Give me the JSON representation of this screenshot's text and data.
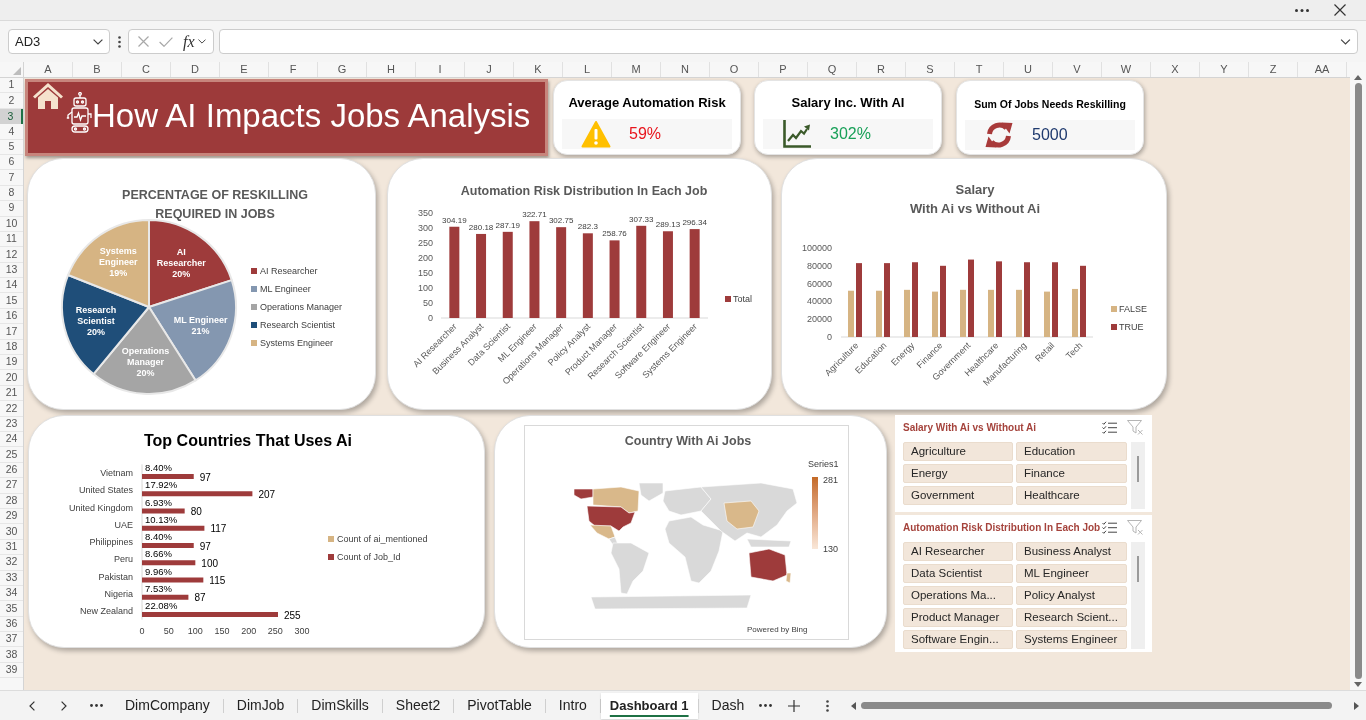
{
  "formula_bar": {
    "name_box": "AD3",
    "function_button": "fx"
  },
  "column_headers": [
    "A",
    "B",
    "C",
    "D",
    "E",
    "F",
    "G",
    "H",
    "I",
    "J",
    "K",
    "L",
    "M",
    "N",
    "O",
    "P",
    "Q",
    "R",
    "S",
    "T",
    "U",
    "V",
    "W",
    "X",
    "Y",
    "Z",
    "AA"
  ],
  "row_headers": [
    {
      "label": "1",
      "selected": false
    },
    {
      "label": "2",
      "selected": false
    },
    {
      "label": "3",
      "selected": true
    },
    {
      "label": "4",
      "selected": false
    },
    {
      "label": "5",
      "selected": false
    },
    {
      "label": "6",
      "selected": false
    },
    {
      "label": "7",
      "selected": false
    },
    {
      "label": "8",
      "selected": false
    },
    {
      "label": "9",
      "selected": false
    },
    {
      "label": "10",
      "selected": false
    },
    {
      "label": "11",
      "selected": false
    },
    {
      "label": "12",
      "selected": false
    },
    {
      "label": "13",
      "selected": false
    },
    {
      "label": "14",
      "selected": false
    },
    {
      "label": "15",
      "selected": false
    },
    {
      "label": "16",
      "selected": false
    },
    {
      "label": "17",
      "selected": false
    },
    {
      "label": "18",
      "selected": false
    },
    {
      "label": "19",
      "selected": false
    },
    {
      "label": "20",
      "selected": false
    },
    {
      "label": "21",
      "selected": false
    },
    {
      "label": "22",
      "selected": false
    },
    {
      "label": "23",
      "selected": false
    },
    {
      "label": "24",
      "selected": false
    },
    {
      "label": "25",
      "selected": false
    },
    {
      "label": "26",
      "selected": false
    },
    {
      "label": "27",
      "selected": false
    },
    {
      "label": "28",
      "selected": false
    },
    {
      "label": "29",
      "selected": false
    },
    {
      "label": "30",
      "selected": false
    },
    {
      "label": "31",
      "selected": false
    },
    {
      "label": "32",
      "selected": false
    },
    {
      "label": "33",
      "selected": false
    },
    {
      "label": "34",
      "selected": false
    },
    {
      "label": "35",
      "selected": false
    },
    {
      "label": "36",
      "selected": false
    },
    {
      "label": "37",
      "selected": false
    },
    {
      "label": "38",
      "selected": false
    },
    {
      "label": "39",
      "selected": false
    }
  ],
  "dashboard": {
    "title": "How AI Impacts Jobs Analysis",
    "kpis": [
      {
        "kind": "warning",
        "title": "Average Automation Risk",
        "value": "59%"
      },
      {
        "kind": "growth",
        "title": "Salary Inc. With AI",
        "value": "302%"
      },
      {
        "kind": "cycle",
        "title": "Sum Of Jobs Needs Reskilling",
        "value": "5000"
      }
    ],
    "reskilling_chart": {
      "chart_data": {
        "type": "pie",
        "title": "PERCENTAGE OF RESKILLING REQUIRED IN JOBS",
        "categories": [
          "AI Researcher",
          "ML Engineer",
          "Operations Manager",
          "Research Scientist",
          "Systems Engineer"
        ],
        "values": [
          20,
          21,
          20,
          20,
          19
        ],
        "colors": [
          "#9e3b3b",
          "#8497b0",
          "#a5a5a5",
          "#1f4e79",
          "#d6b483"
        ],
        "data_labels": "value_labels",
        "value_labels": [
          "20%",
          "21%",
          "20%",
          "20%",
          "19%"
        ],
        "legend": "right"
      }
    },
    "automation_chart": {
      "chart_data": {
        "type": "bar",
        "title": "Automation Risk Distribution In Each Job",
        "categories": [
          "AI Researcher",
          "Business Analyst",
          "Data Scientist",
          "ML Engineer",
          "Operations Manager",
          "Policy Analyst",
          "Product Manager",
          "Research Scientist",
          "Software Engineer",
          "Systems Engineer"
        ],
        "series": [
          {
            "name": "Total",
            "color": "#9e3b3b",
            "values": [
              304.19,
              280.18,
              287.19,
              322.71,
              302.75,
              282.3,
              258.76,
              307.33,
              289.13,
              296.34
            ]
          }
        ],
        "ylim": [
          0,
          350
        ],
        "yticks": [
          0,
          50,
          100,
          150,
          200,
          250,
          300,
          350
        ],
        "data_labels": true,
        "legend": "right"
      }
    },
    "salary_chart": {
      "chart_data": {
        "type": "bar",
        "title": "Salary\nWith Ai vs Without Ai",
        "categories": [
          "Agriculture",
          "Education",
          "Energy",
          "Finance",
          "Government",
          "Healthcare",
          "Manufacturing",
          "Retail",
          "Tech"
        ],
        "series": [
          {
            "name": "FALSE",
            "color": "#d6b483",
            "values": [
              52000,
              52000,
              53000,
              51000,
              53000,
              53000,
              53000,
              51000,
              54000
            ]
          },
          {
            "name": "TRUE",
            "color": "#9e3b3b",
            "values": [
              83000,
              83000,
              84000,
              80000,
              87000,
              85000,
              84000,
              84000,
              80000
            ]
          }
        ],
        "ylim": [
          0,
          100000
        ],
        "yticks": [
          0,
          20000,
          40000,
          60000,
          80000,
          100000
        ],
        "legend": "right"
      }
    },
    "countries_chart": {
      "chart_data": {
        "type": "bar",
        "orientation": "horizontal",
        "title": "Top Countries That Uses Ai",
        "categories": [
          "Vietnam",
          "United States",
          "United Kingdom",
          "UAE",
          "Philippines",
          "Peru",
          "Pakistan",
          "Nigeria",
          "New Zealand"
        ],
        "series": [
          {
            "name": "Count of ai_mentioned",
            "color": "#d6b483",
            "values": [
              0.084,
              0.1792,
              0.0693,
              0.1013,
              0.084,
              0.0866,
              0.0996,
              0.0753,
              0.2208
            ],
            "value_labels": [
              "8.40%",
              "17.92%",
              "6.93%",
              "10.13%",
              "8.40%",
              "8.66%",
              "9.96%",
              "7.53%",
              "22.08%"
            ]
          },
          {
            "name": "Count of Job_Id",
            "color": "#9e3b3b",
            "values": [
              97,
              207,
              80,
              117,
              97,
              100,
              115,
              87,
              255
            ]
          }
        ],
        "xlim": [
          0,
          300
        ],
        "xticks": [
          0,
          50,
          100,
          150,
          200,
          250,
          300
        ],
        "data_labels": true,
        "legend": "right"
      }
    },
    "map_chart": {
      "title": "Country With Ai Jobs",
      "legend_title": "Series1",
      "scale_max": "281",
      "scale_min": "130",
      "credit": "Powered by Bing"
    },
    "slicers": [
      {
        "title": "Salary With Ai vs Without Ai",
        "items": [
          {
            "label": "Agriculture",
            "selected": true
          },
          {
            "label": "Education",
            "selected": true
          },
          {
            "label": "Energy",
            "selected": true
          },
          {
            "label": "Finance",
            "selected": true
          },
          {
            "label": "Government",
            "selected": true
          },
          {
            "label": "Healthcare",
            "selected": true
          }
        ]
      },
      {
        "title": "Automation Risk Distribution In Each Job",
        "items": [
          {
            "label": "AI Researcher",
            "selected": true
          },
          {
            "label": "Business Analyst",
            "selected": true
          },
          {
            "label": "Data Scientist",
            "selected": true
          },
          {
            "label": "ML Engineer",
            "selected": true
          },
          {
            "label": "Operations Ma...",
            "selected": true
          },
          {
            "label": "Policy Analyst",
            "selected": true
          },
          {
            "label": "Product Manager",
            "selected": true
          },
          {
            "label": "Research Scient...",
            "selected": true
          },
          {
            "label": "Software Engin...",
            "selected": true
          },
          {
            "label": "Systems Engineer",
            "selected": true
          }
        ]
      }
    ]
  },
  "sheet_tabs": [
    {
      "label": "DimCompany",
      "selected": false
    },
    {
      "label": "DimJob",
      "selected": false
    },
    {
      "label": "DimSkills",
      "selected": false
    },
    {
      "label": "Sheet2",
      "selected": false
    },
    {
      "label": "PivotTable",
      "selected": false
    },
    {
      "label": "Intro",
      "selected": false
    },
    {
      "label": "Dashboard 1",
      "selected": true
    },
    {
      "label": "Dash",
      "selected": false
    }
  ]
}
